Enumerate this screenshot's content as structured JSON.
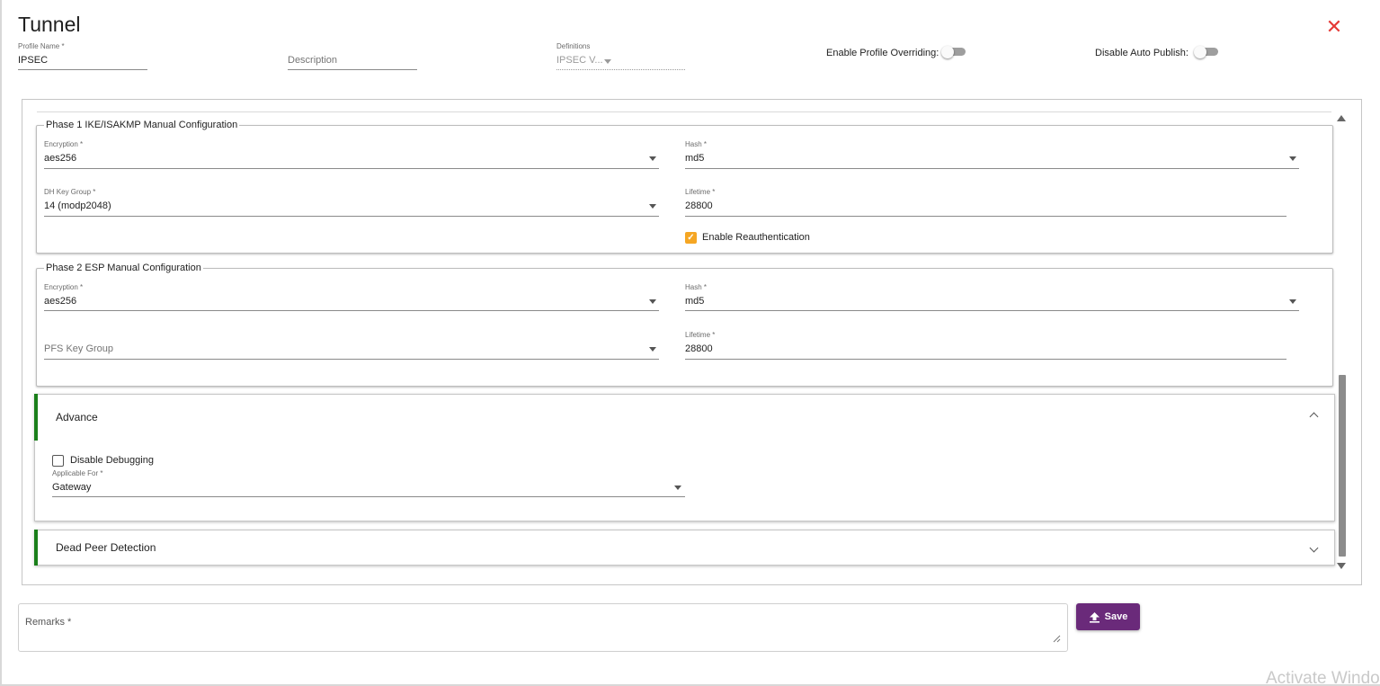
{
  "dialog": {
    "title": "Tunnel",
    "close_icon": "close-icon",
    "accent_close": "#e53935"
  },
  "header_fields": {
    "profile_name": {
      "label": "Profile Name *",
      "value": "IPSEC"
    },
    "description": {
      "placeholder": "Description"
    },
    "definitions": {
      "label": "Definitions",
      "value": "IPSEC V..."
    },
    "enable_profile_overriding": {
      "label": "Enable Profile Overriding:",
      "on": false
    },
    "disable_auto_publish": {
      "label": "Disable Auto Publish:",
      "on": false
    }
  },
  "phase1": {
    "legend": "Phase 1 IKE/ISAKMP Manual Configuration",
    "encryption": {
      "label": "Encryption *",
      "value": "aes256"
    },
    "hash": {
      "label": "Hash *",
      "value": "md5"
    },
    "dh_key_group": {
      "label": "DH Key Group *",
      "value": "14 (modp2048)"
    },
    "lifetime": {
      "label": "Lifetime *",
      "value": "28800"
    },
    "enable_reauth": {
      "label": "Enable Reauthentication",
      "checked": true
    }
  },
  "phase2": {
    "legend": "Phase 2 ESP Manual Configuration",
    "encryption": {
      "label": "Encryption *",
      "value": "aes256"
    },
    "hash": {
      "label": "Hash *",
      "value": "md5"
    },
    "pfs_key_group": {
      "placeholder": "PFS Key Group"
    },
    "lifetime": {
      "label": "Lifetime *",
      "value": "28800"
    }
  },
  "advance": {
    "title": "Advance",
    "expanded": true,
    "disable_debugging": {
      "label": "Disable Debugging",
      "checked": false
    },
    "applicable_for": {
      "label": "Applicable For *",
      "value": "Gateway"
    }
  },
  "dead_peer_detection": {
    "title": "Dead Peer Detection",
    "expanded": false
  },
  "footer": {
    "remarks_label": "Remarks *",
    "save_label": "Save",
    "save_icon": "upload-icon",
    "save_color": "#6a2a7a"
  },
  "watermark": "Activate Windo",
  "colors": {
    "accordion_accent": "#1a7f1a",
    "checkbox_checked": "#f5a623"
  }
}
